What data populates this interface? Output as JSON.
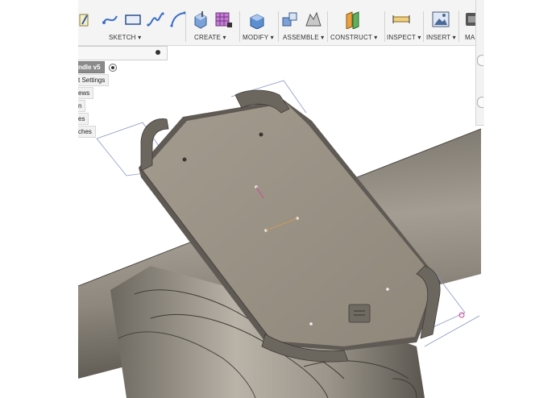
{
  "toolbar": {
    "groups": [
      {
        "label": "SKETCH ▾"
      },
      {
        "label": "CREATE ▾"
      },
      {
        "label": "MODIFY ▾"
      },
      {
        "label": "ASSEMBLE ▾"
      },
      {
        "label": "CONSTRUCT ▾"
      },
      {
        "label": "INSPECT ▾"
      },
      {
        "label": "INSERT ▾"
      },
      {
        "label": "MA"
      }
    ]
  },
  "browser": {
    "items": [
      {
        "label": "ndle v5"
      },
      {
        "label": "t Settings"
      },
      {
        "label": "ews"
      },
      {
        "label": "n"
      },
      {
        "label": "es"
      },
      {
        "label": "ches"
      }
    ]
  },
  "colors": {
    "model_gray": "#8a8479",
    "plate_top": "#9a9184",
    "toolbar_bg": "#f4f4f4",
    "sketch_line": "#8a97c8",
    "accent_pink": "#d04890"
  }
}
